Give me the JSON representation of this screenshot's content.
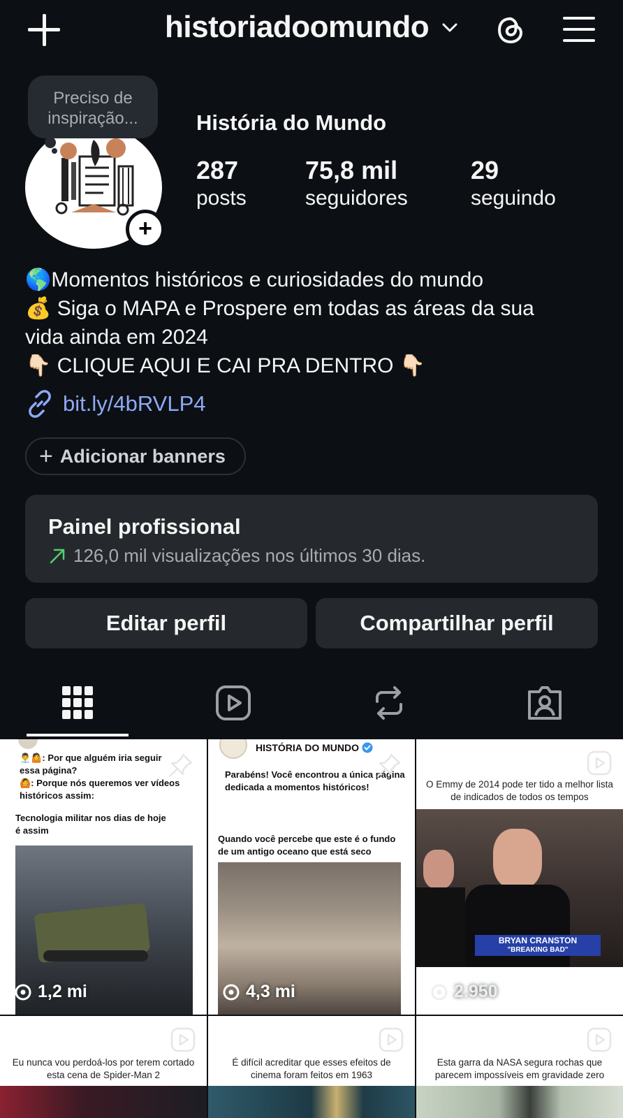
{
  "header": {
    "username": "historiadoomundo",
    "icons": [
      "plus-icon",
      "chevron-down-icon",
      "threads-icon",
      "menu-icon"
    ]
  },
  "profile": {
    "note": "Preciso de inspiração...",
    "display_name": "História do Mundo",
    "stats": {
      "posts_count": "287",
      "posts_label": "posts",
      "followers_count": "75,8 mil",
      "followers_label": "seguidores",
      "following_count": "29",
      "following_label": "seguindo"
    },
    "bio": [
      "🌎Momentos históricos e curiosidades do mundo",
      "💰 Siga o MAPA e Prospere em todas as áreas da sua",
      "vida ainda em 2024",
      "👇🏻 CLIQUE AQUI E CAI PRA DENTRO 👇🏻"
    ],
    "link": "bit.ly/4bRVLP4"
  },
  "banner_button": "Adicionar banners",
  "professional_panel": {
    "title": "Painel profissional",
    "subtitle": "126,0 mil visualizações nos últimos 30 dias.",
    "accent": "#4fd16b"
  },
  "actions": {
    "edit": "Editar perfil",
    "share": "Compartilhar perfil"
  },
  "tabs": [
    "grid-icon",
    "reels-icon",
    "reposts-icon",
    "tagged-icon"
  ],
  "grid": {
    "posts": [
      {
        "line1": "👨‍💼🤷: Por que alguém iria seguir",
        "line2": "essa página?",
        "line3": "🙆: Porque nós queremos ver vídeos",
        "line4": "históricos assim:",
        "heading1": "Tecnologia militar nos dias de hoje",
        "heading2": "é assim",
        "views": "1,2 mi"
      },
      {
        "brand": "HISTÓRIA DO MUNDO",
        "line1": "Parabéns! Você encontrou a única página",
        "line2": "dedicada a momentos históricos!",
        "heading1": "Quando você percebe que este é o fundo",
        "heading2": "de um antigo oceano que está seco",
        "views": "4,3 mi"
      },
      {
        "caption1": "O Emmy de 2014 pode ter tido a melhor lista",
        "caption2": "de indicados de todos os tempos",
        "lower_third1": "BRYAN CRANSTON",
        "lower_third2": "\"BREAKING BAD\"",
        "views": "2.950"
      },
      {
        "caption1": "Eu nunca vou perdoá-los por terem cortado",
        "caption2": "esta cena de Spider-Man 2"
      },
      {
        "caption1": "É difícil acreditar que esses efeitos de",
        "caption2": "cinema foram feitos em 1963"
      },
      {
        "caption1": "Esta garra da NASA segura rochas que",
        "caption2": "parecem impossíveis em gravidade zero"
      }
    ]
  },
  "colors": {
    "background": "#0c1014",
    "surface": "#25292e",
    "link": "#8fa9f5",
    "text": "#f5f5f5"
  }
}
